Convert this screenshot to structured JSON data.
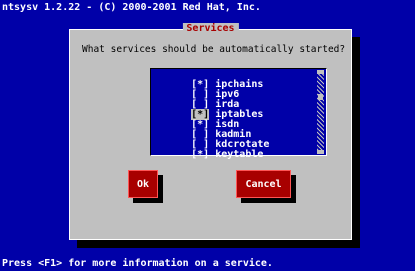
{
  "app_title": "ntsysv 1.2.22 - (C) 2000-2001 Red Hat, Inc.",
  "status_bar": "Press <F1> for more information on a service.",
  "dialog": {
    "title": "Services",
    "question": "What services should be automatically started?",
    "items": [
      {
        "label": "ipchains",
        "checked": true,
        "mark": "[*]"
      },
      {
        "label": "ipv6",
        "checked": false,
        "mark": "[ ]"
      },
      {
        "label": "irda",
        "checked": false,
        "mark": "[ ]"
      },
      {
        "label": "iptables",
        "checked": true,
        "mark": "[*]"
      },
      {
        "label": "isdn",
        "checked": true,
        "mark": "[*]"
      },
      {
        "label": "kadmin",
        "checked": false,
        "mark": "[ ]"
      },
      {
        "label": "kdcrotate",
        "checked": false,
        "mark": "[ ]"
      },
      {
        "label": "keytable",
        "checked": true,
        "mark": "[*]"
      }
    ],
    "ok_label": "Ok",
    "cancel_label": "Cancel"
  },
  "colors": {
    "background": "#0000a8",
    "dialog": "#c0c0c0",
    "button": "#a80000",
    "title": "#a80000"
  }
}
